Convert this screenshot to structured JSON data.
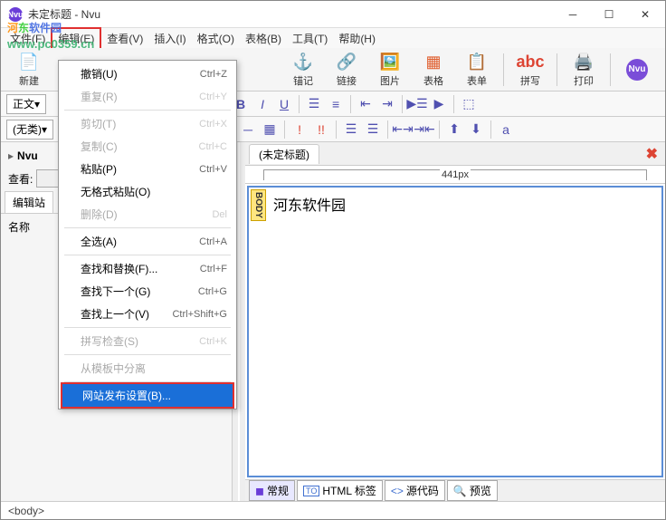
{
  "window": {
    "title": "未定标题 - Nvu",
    "icon_text": "Nvu"
  },
  "watermark": {
    "brand": "河东软件园",
    "url": "www.pc0359.cn"
  },
  "menubar": {
    "file": "文件(F)",
    "edit": "编辑(E)",
    "view": "查看(V)",
    "insert": "插入(I)",
    "format": "格式(O)",
    "table": "表格(B)",
    "tools": "工具(T)",
    "help": "帮助(H)"
  },
  "toolbar": {
    "new": "新建",
    "anchor": "锚记",
    "link": "链接",
    "image": "图片",
    "table": "表格",
    "form": "表单",
    "spell": "拼写",
    "print": "打印"
  },
  "format_dropdown": {
    "body_text": "正文",
    "no_class": "(无类)"
  },
  "sidebar": {
    "app_label": "Nvu",
    "close": "×",
    "look_label": "查看:",
    "tabs": {
      "edit_site": "编辑站"
    },
    "name_col": "名称"
  },
  "document_tab": {
    "title": "(未定标题)"
  },
  "ruler": {
    "width_label": "441px"
  },
  "editor": {
    "body_tag": "BODY",
    "content": "河东软件园"
  },
  "view_tabs": {
    "normal": "常规",
    "html_tags": "HTML 标签",
    "source": "源代码",
    "preview": "预览"
  },
  "statusbar": {
    "path": "<body>"
  },
  "context_menu": {
    "undo": {
      "label": "撤销(U)",
      "shortcut": "Ctrl+Z"
    },
    "redo": {
      "label": "重复(R)",
      "shortcut": "Ctrl+Y"
    },
    "cut": {
      "label": "剪切(T)",
      "shortcut": "Ctrl+X"
    },
    "copy": {
      "label": "复制(C)",
      "shortcut": "Ctrl+C"
    },
    "paste": {
      "label": "粘贴(P)",
      "shortcut": "Ctrl+V"
    },
    "paste_plain": {
      "label": "无格式粘贴(O)"
    },
    "delete": {
      "label": "删除(D)",
      "shortcut": "Del"
    },
    "select_all": {
      "label": "全选(A)",
      "shortcut": "Ctrl+A"
    },
    "find_replace": {
      "label": "查找和替换(F)...",
      "shortcut": "Ctrl+F"
    },
    "find_next": {
      "label": "查找下一个(G)",
      "shortcut": "Ctrl+G"
    },
    "find_prev": {
      "label": "查找上一个(V)",
      "shortcut": "Ctrl+Shift+G"
    },
    "spell_check": {
      "label": "拼写检查(S)",
      "shortcut": "Ctrl+K"
    },
    "detach_template": {
      "label": "从模板中分离"
    },
    "publish_settings": {
      "label": "网站发布设置(B)..."
    }
  }
}
